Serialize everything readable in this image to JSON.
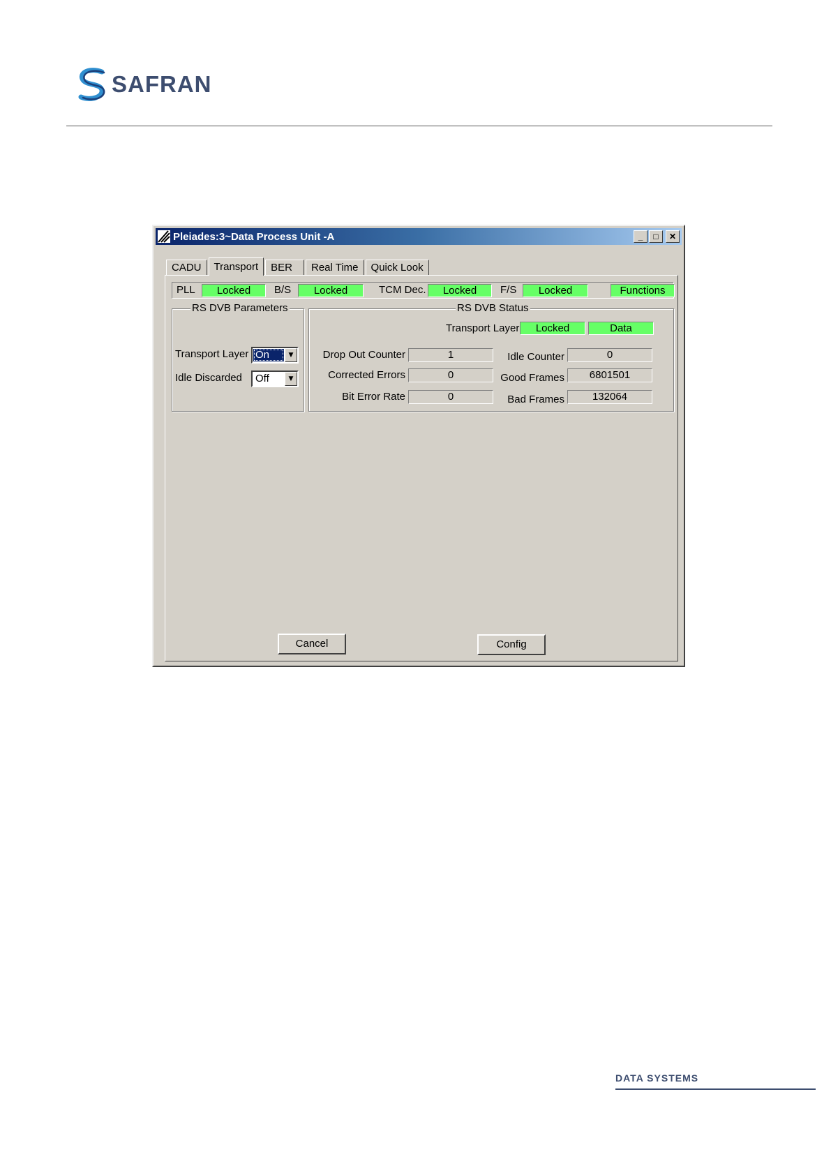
{
  "page": {
    "logo_text": "SAFRAN",
    "footer_text": "DATA SYSTEMS"
  },
  "window": {
    "title": "Pleiades:3~Data Process Unit -A",
    "controls": {
      "minimize": "_",
      "maximize": "□",
      "close": "✕"
    }
  },
  "tabs": [
    {
      "label": "CADU",
      "active": false
    },
    {
      "label": "Transport",
      "active": true
    },
    {
      "label": "BER",
      "active": false
    },
    {
      "label": "Real Time",
      "active": false
    },
    {
      "label": "Quick Look",
      "active": false
    }
  ],
  "status_strip": {
    "pll_label": "PLL",
    "pll_value": "Locked",
    "bs_label": "B/S",
    "bs_value": "Locked",
    "tcm_label": "TCM Dec.",
    "tcm_value": "Locked",
    "fs_label": "F/S",
    "fs_value": "Locked",
    "functions_label": "Functions",
    "indicator_color": "#66ff66"
  },
  "rs_dvb_parameters": {
    "title": "RS DVB Parameters",
    "transport_layer_label": "Transport Layer",
    "transport_layer_value": "On",
    "idle_discarded_label": "Idle Discarded",
    "idle_discarded_value": "Off"
  },
  "rs_dvb_status": {
    "title": "RS DVB Status",
    "transport_layer_label": "Transport Layer",
    "transport_layer_status": "Locked",
    "transport_layer_data": "Data",
    "drop_out_counter_label": "Drop Out Counter",
    "drop_out_counter_value": "1",
    "corrected_errors_label": "Corrected Errors",
    "corrected_errors_value": "0",
    "bit_error_rate_label": "Bit Error Rate",
    "bit_error_rate_value": "0",
    "idle_counter_label": "Idle Counter",
    "idle_counter_value": "0",
    "good_frames_label": "Good Frames",
    "good_frames_value": "6801501",
    "bad_frames_label": "Bad Frames",
    "bad_frames_value": "132064"
  },
  "buttons": {
    "cancel": "Cancel",
    "config": "Config"
  },
  "icons": {
    "dropdown": "chevron-down-icon"
  }
}
